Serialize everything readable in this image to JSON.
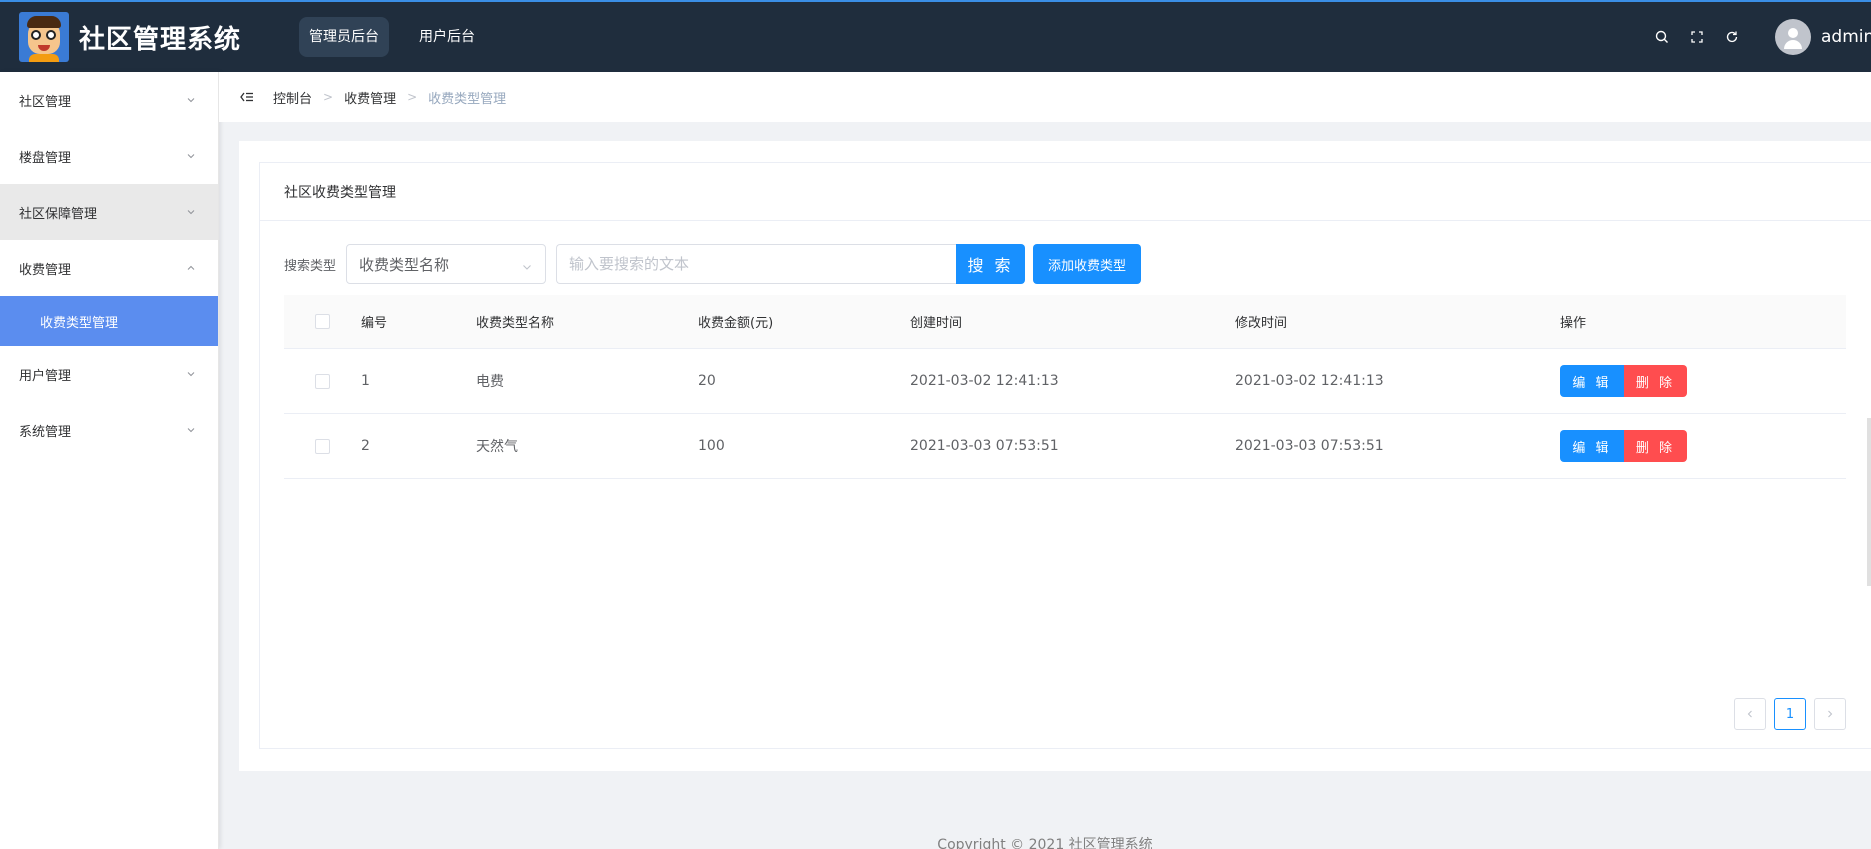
{
  "header": {
    "app_title": "社区管理系统",
    "nav": [
      {
        "label": "管理员后台",
        "active": true
      },
      {
        "label": "用户后台",
        "active": false
      }
    ],
    "username": "admin",
    "icons": [
      "search-icon",
      "fullscreen-icon",
      "refresh-icon",
      "avatar"
    ]
  },
  "sidebar": {
    "items": [
      {
        "label": "社区管理",
        "expanded": false
      },
      {
        "label": "楼盘管理",
        "expanded": false
      },
      {
        "label": "社区保障管理",
        "expanded": false,
        "hover": true
      },
      {
        "label": "收费管理",
        "expanded": true,
        "children": [
          {
            "label": "收费类型管理",
            "active": true
          }
        ]
      },
      {
        "label": "用户管理",
        "expanded": false
      },
      {
        "label": "系统管理",
        "expanded": false
      }
    ]
  },
  "breadcrumb": [
    "控制台",
    "收费管理",
    "收费类型管理"
  ],
  "card": {
    "title": "社区收费类型管理",
    "search": {
      "label": "搜索类型",
      "select_value": "收费类型名称",
      "placeholder": "输入要搜索的文本",
      "search_button": "搜 索",
      "add_button": "添加收费类型"
    },
    "table": {
      "columns": [
        "编号",
        "收费类型名称",
        "收费金额(元)",
        "创建时间",
        "修改时间",
        "操作"
      ],
      "rows": [
        {
          "id": "1",
          "name": "电费",
          "amount": "20",
          "created": "2021-03-02 12:41:13",
          "modified": "2021-03-02 12:41:13"
        },
        {
          "id": "2",
          "name": "天然气",
          "amount": "100",
          "created": "2021-03-03 07:53:51",
          "modified": "2021-03-03 07:53:51"
        }
      ],
      "edit_label": "编 辑",
      "delete_label": "删 除"
    },
    "pagination": {
      "current": "1"
    }
  },
  "footer": "Copyright © 2021 社区管理系统",
  "colors": {
    "header_bg": "#1f2d3d",
    "primary": "#1890ff",
    "danger": "#ff4d4f",
    "submenu_active": "#5b8def"
  }
}
